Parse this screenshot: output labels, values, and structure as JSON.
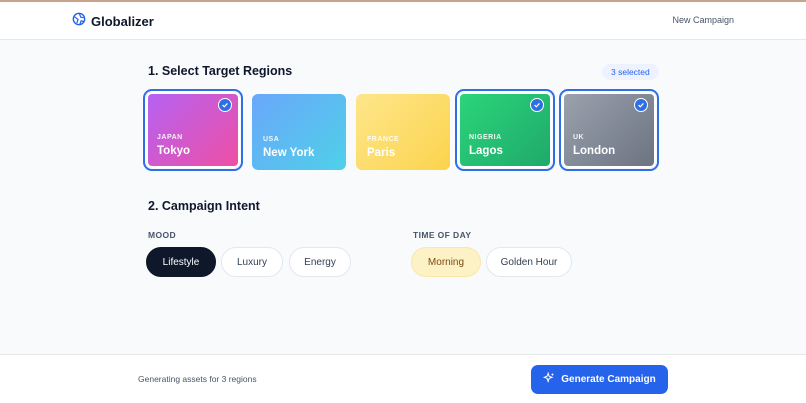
{
  "app": {
    "name": "Globalizer"
  },
  "header": {
    "new_campaign": "New Campaign"
  },
  "regions_section": {
    "title": "1. Select Target Regions",
    "selected_badge": "3 selected",
    "regions": [
      {
        "country": "JAPAN",
        "city": "Tokyo",
        "selected": true,
        "gradient": [
          "#b462f5",
          "#ef4fa2"
        ]
      },
      {
        "country": "USA",
        "city": "New York",
        "selected": false,
        "gradient": [
          "#6aa7fb",
          "#4fd0e9"
        ]
      },
      {
        "country": "FRANCE",
        "city": "Paris",
        "selected": false,
        "gradient": [
          "#fde68a",
          "#fcd34d"
        ]
      },
      {
        "country": "NIGERIA",
        "city": "Lagos",
        "selected": true,
        "gradient": [
          "#2bd67b",
          "#1fa86a"
        ]
      },
      {
        "country": "UK",
        "city": "London",
        "selected": true,
        "gradient": [
          "#9ca3af",
          "#6b7280"
        ]
      }
    ]
  },
  "intent_section": {
    "title": "2. Campaign Intent",
    "mood": {
      "label": "MOOD",
      "options": [
        "Lifestyle",
        "Luxury",
        "Energy"
      ],
      "selected": "Lifestyle"
    },
    "time_of_day": {
      "label": "TIME OF DAY",
      "options": [
        "Morning",
        "Golden Hour"
      ],
      "selected": "Morning"
    }
  },
  "footer": {
    "status": "Generating assets for 3 regions",
    "generate_label": "Generate Campaign"
  },
  "colors": {
    "accent": "#2563eb",
    "dark": "#0f172a"
  }
}
